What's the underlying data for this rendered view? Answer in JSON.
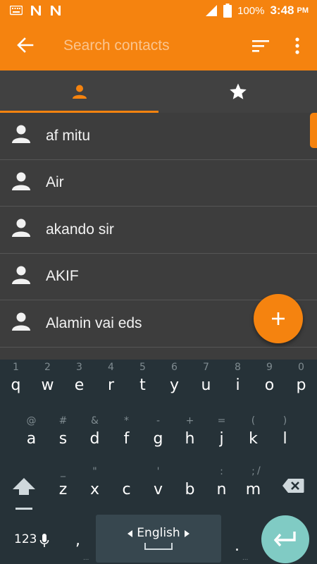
{
  "status_bar": {
    "battery": "100%",
    "time": "3:48",
    "ampm": "PM"
  },
  "app_bar": {
    "search_placeholder": "Search contacts"
  },
  "contacts": [
    {
      "name": "af mitu"
    },
    {
      "name": "Air"
    },
    {
      "name": "akando sir"
    },
    {
      "name": "AKIF"
    },
    {
      "name": "Alamin vai eds"
    }
  ],
  "keyboard": {
    "row1": [
      {
        "hint": "1",
        "ch": "q"
      },
      {
        "hint": "2",
        "ch": "w"
      },
      {
        "hint": "3",
        "ch": "e"
      },
      {
        "hint": "4",
        "ch": "r"
      },
      {
        "hint": "5",
        "ch": "t"
      },
      {
        "hint": "6",
        "ch": "y"
      },
      {
        "hint": "7",
        "ch": "u"
      },
      {
        "hint": "8",
        "ch": "i"
      },
      {
        "hint": "9",
        "ch": "o"
      },
      {
        "hint": "0",
        "ch": "p"
      }
    ],
    "row2": [
      {
        "hint": "@",
        "ch": "a"
      },
      {
        "hint": "#",
        "ch": "s"
      },
      {
        "hint": "&",
        "ch": "d"
      },
      {
        "hint": "*",
        "ch": "f"
      },
      {
        "hint": "-",
        "ch": "g"
      },
      {
        "hint": "+",
        "ch": "h"
      },
      {
        "hint": "=",
        "ch": "j"
      },
      {
        "hint": "(",
        "ch": "k"
      },
      {
        "hint": ")",
        "ch": "l"
      }
    ],
    "row3": [
      {
        "hint": "_",
        "ch": "z"
      },
      {
        "hint": "\"",
        "ch": "x"
      },
      {
        "hint": "",
        "ch": "c"
      },
      {
        "hint": "'",
        "ch": "v"
      },
      {
        "hint": "",
        "ch": "b"
      },
      {
        "hint": ":",
        "ch": "n"
      },
      {
        "hint": ";",
        "ch": "m"
      }
    ],
    "row3_extra_hint": "/",
    "numbers_label": "123",
    "comma": ",",
    "language": "English",
    "period": ".",
    "more_dots": "..."
  },
  "colors": {
    "accent": "#f5830f",
    "background": "#3d3d3d",
    "keyboard_bg": "#263238",
    "enter_key": "#80cbc4"
  },
  "icons": [
    "keyboard-icon",
    "n-icon",
    "signal-icon",
    "battery-icon",
    "back-arrow-icon",
    "sort-icon",
    "more-vert-icon",
    "person-icon",
    "star-icon",
    "add-icon",
    "shift-icon",
    "backspace-icon",
    "mic-icon",
    "enter-icon"
  ]
}
